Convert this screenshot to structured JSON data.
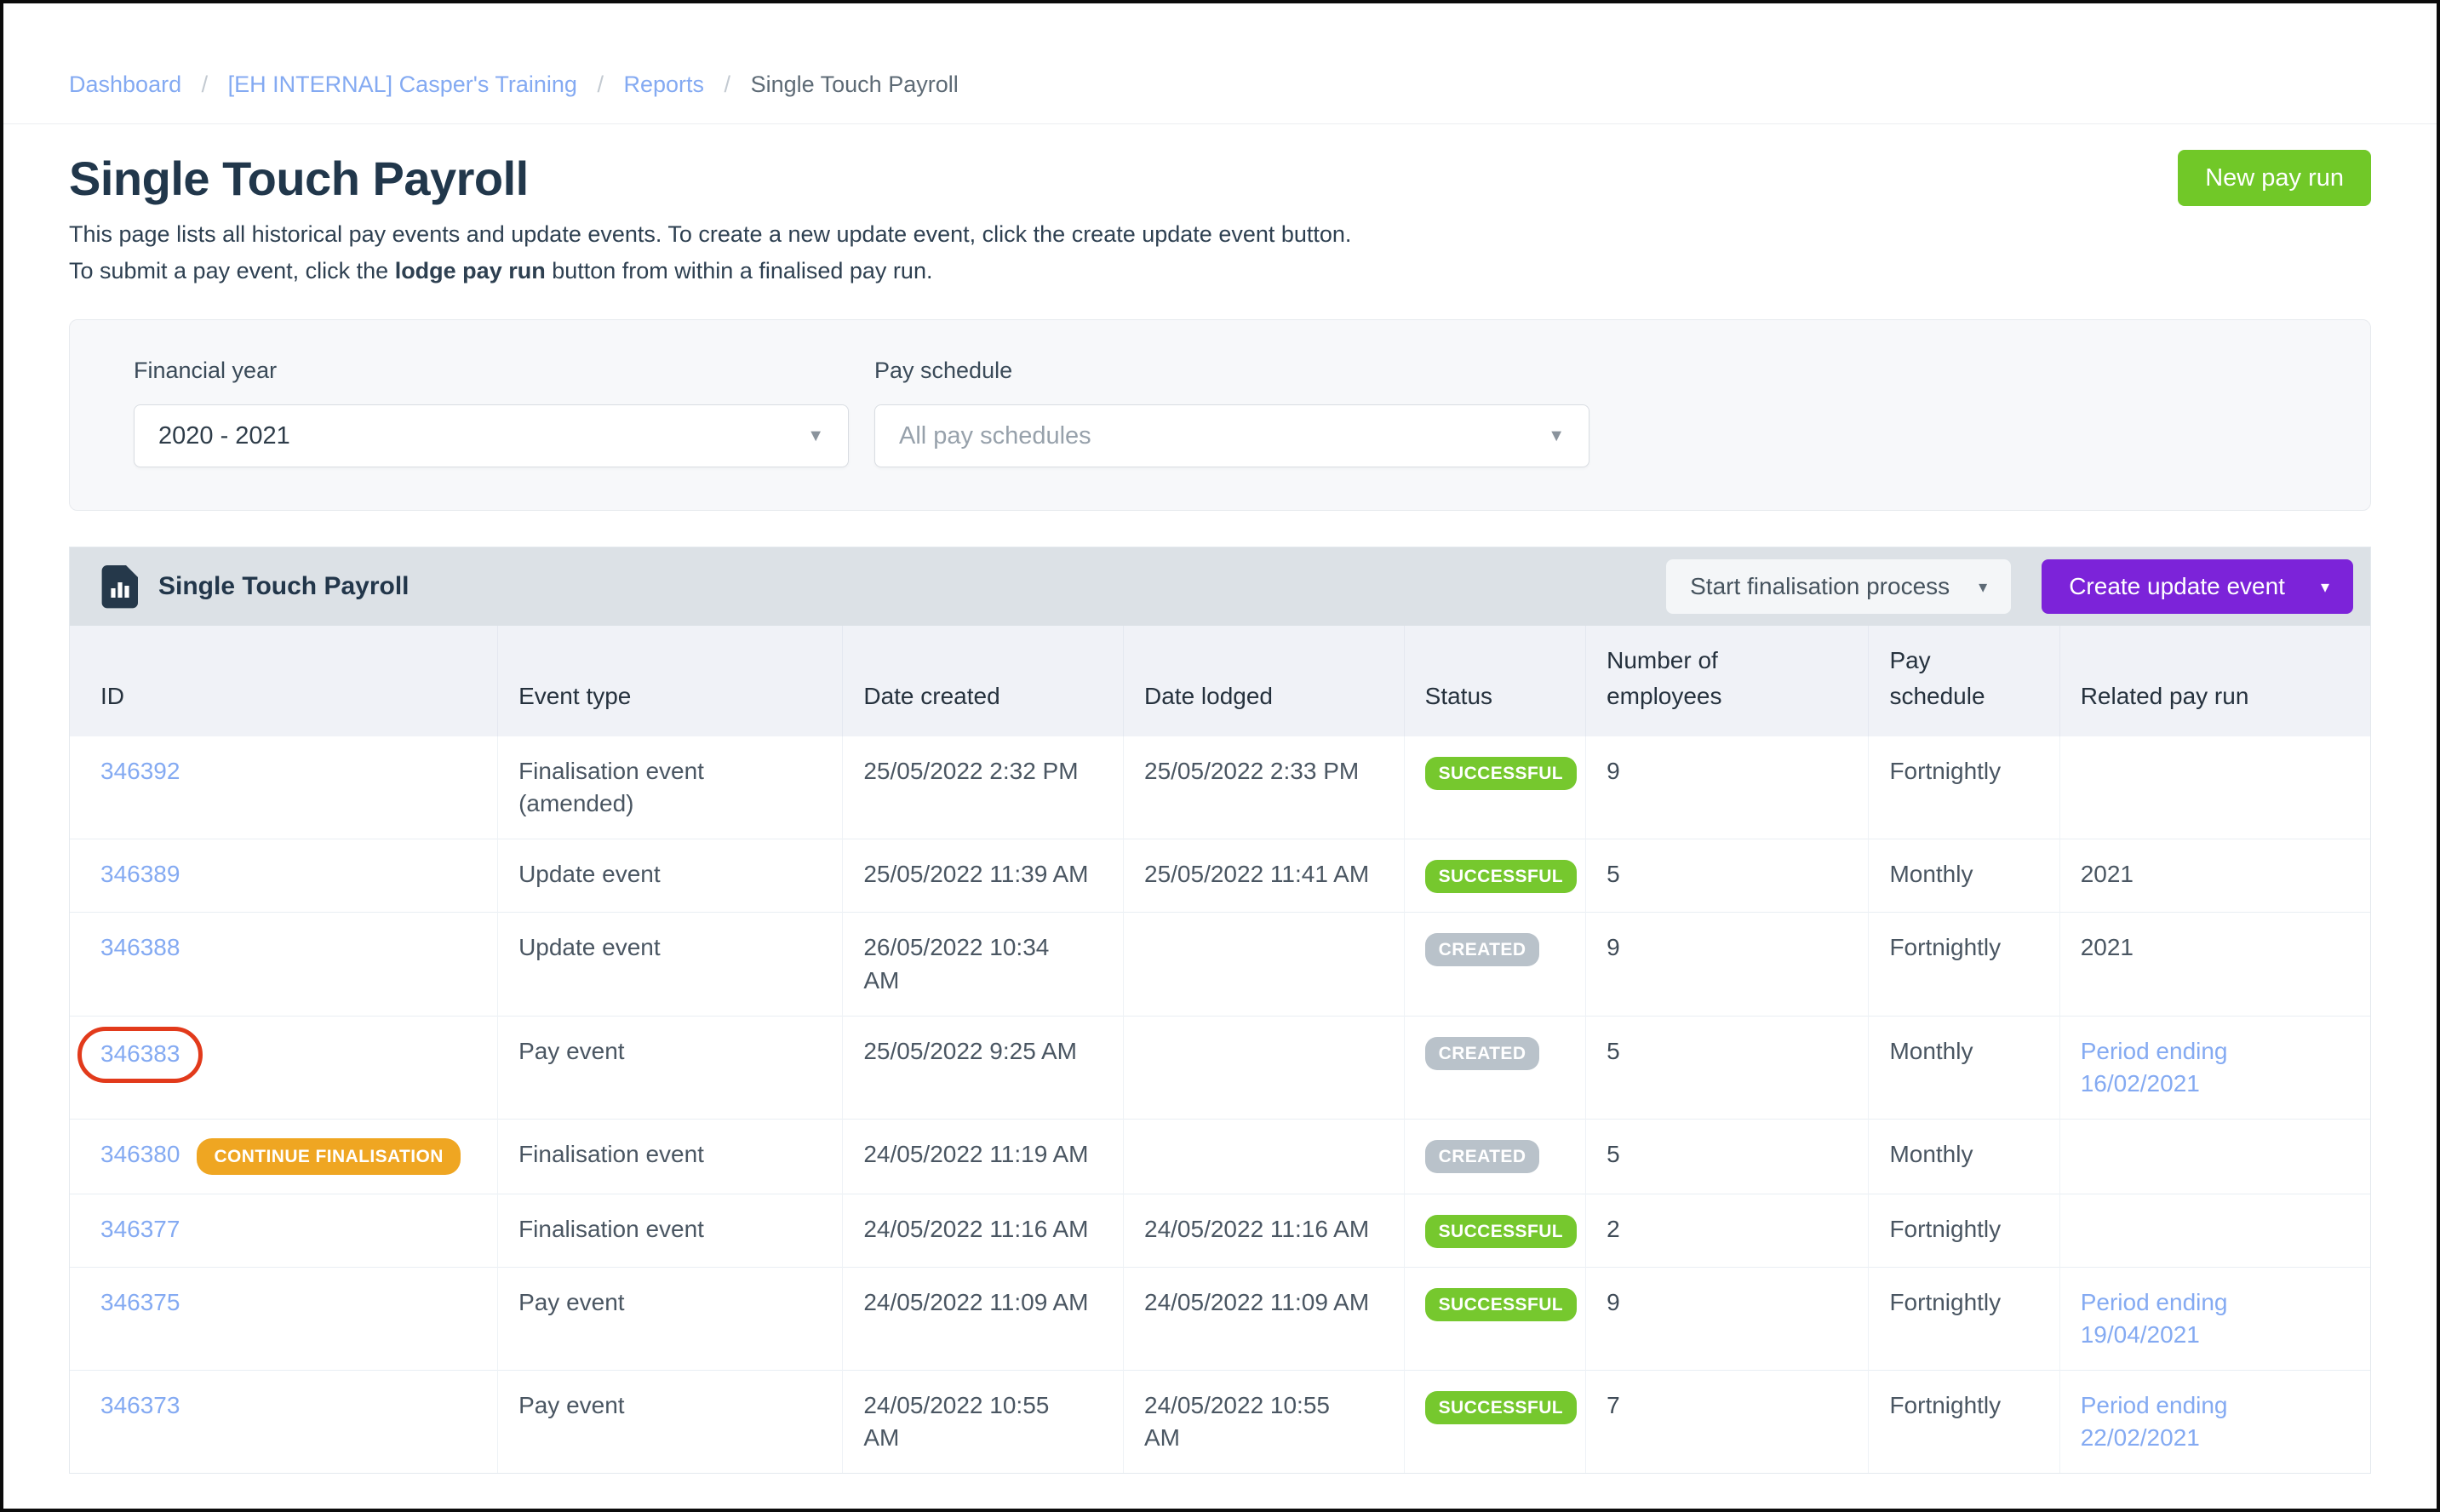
{
  "colors": {
    "accent_green": "#71c828",
    "accent_purple": "#7c23d9",
    "badge_success_green": "#76c82e",
    "badge_created_gray": "#b9c2ca",
    "badge_continue_orange": "#efa622",
    "link_blue": "#84aaf2",
    "annotation_circle_red": "#e23a1b",
    "table_bar_gray": "#dce1e6",
    "header_row_gray": "#f0f2f7"
  },
  "icons": {
    "caret_down": "▾",
    "select_caret": "▼",
    "table_icon": "bar-chart-file"
  },
  "breadcrumb": {
    "separator": "/",
    "links": [
      "Dashboard",
      "[EH INTERNAL] Casper's Training",
      "Reports"
    ],
    "current": "Single Touch Payroll"
  },
  "page_header": {
    "title": "Single Touch Payroll",
    "new_pay_run_label": "New pay run",
    "description_line1": "This page lists all historical pay events and update events. To create a new update event, click the create update event button.",
    "description_line2_prefix": "To submit a pay event, click the ",
    "description_line2_bold": "lodge pay run",
    "description_line2_suffix": " button from within a finalised pay run."
  },
  "filters": {
    "financial_year_label": "Financial year",
    "financial_year_value": "2020 - 2021",
    "pay_schedule_label": "Pay schedule",
    "pay_schedule_placeholder": "All pay schedules"
  },
  "table": {
    "title": "Single Touch Payroll",
    "start_finalisation_label": "Start finalisation process",
    "create_update_event_label": "Create update event",
    "columns": [
      "ID",
      "Event type",
      "Date created",
      "Date lodged",
      "Status",
      "Number of\nemployees",
      "Pay\nschedule",
      "Related pay run"
    ],
    "rows": [
      {
        "id": "346392",
        "circled": false,
        "id_badge": "",
        "event_type": "Finalisation event\n(amended)",
        "date_created": "25/05/2022 2:32 PM",
        "date_lodged": "25/05/2022 2:33 PM",
        "status": "SUCCESSFUL",
        "status_variant": "success",
        "employees": "9",
        "pay_schedule": "Fortnightly",
        "related": "",
        "related_is_link": false
      },
      {
        "id": "346389",
        "circled": false,
        "id_badge": "",
        "event_type": "Update event",
        "date_created": "25/05/2022 11:39 AM",
        "date_lodged": "25/05/2022 11:41 AM",
        "status": "SUCCESSFUL",
        "status_variant": "success",
        "employees": "5",
        "pay_schedule": "Monthly",
        "related": "2021",
        "related_is_link": false
      },
      {
        "id": "346388",
        "circled": false,
        "id_badge": "",
        "event_type": "Update event",
        "date_created": "26/05/2022 10:34\nAM",
        "date_lodged": "",
        "status": "CREATED",
        "status_variant": "created",
        "employees": "9",
        "pay_schedule": "Fortnightly",
        "related": "2021",
        "related_is_link": false
      },
      {
        "id": "346383",
        "circled": true,
        "id_badge": "",
        "event_type": "Pay event",
        "date_created": "25/05/2022 9:25 AM",
        "date_lodged": "",
        "status": "CREATED",
        "status_variant": "created",
        "employees": "5",
        "pay_schedule": "Monthly",
        "related": "Period ending\n16/02/2021",
        "related_is_link": true
      },
      {
        "id": "346380",
        "circled": false,
        "id_badge": "CONTINUE FINALISATION",
        "event_type": "Finalisation event",
        "date_created": "24/05/2022 11:19 AM",
        "date_lodged": "",
        "status": "CREATED",
        "status_variant": "created",
        "employees": "5",
        "pay_schedule": "Monthly",
        "related": "",
        "related_is_link": false
      },
      {
        "id": "346377",
        "circled": false,
        "id_badge": "",
        "event_type": "Finalisation event",
        "date_created": "24/05/2022 11:16 AM",
        "date_lodged": "24/05/2022 11:16 AM",
        "status": "SUCCESSFUL",
        "status_variant": "success",
        "employees": "2",
        "pay_schedule": "Fortnightly",
        "related": "",
        "related_is_link": false
      },
      {
        "id": "346375",
        "circled": false,
        "id_badge": "",
        "event_type": "Pay event",
        "date_created": "24/05/2022 11:09 AM",
        "date_lodged": "24/05/2022 11:09 AM",
        "status": "SUCCESSFUL",
        "status_variant": "success",
        "employees": "9",
        "pay_schedule": "Fortnightly",
        "related": "Period ending\n19/04/2021",
        "related_is_link": true
      },
      {
        "id": "346373",
        "circled": false,
        "id_badge": "",
        "event_type": "Pay event",
        "date_created": "24/05/2022 10:55\nAM",
        "date_lodged": "24/05/2022 10:55\nAM",
        "status": "SUCCESSFUL",
        "status_variant": "success",
        "employees": "7",
        "pay_schedule": "Fortnightly",
        "related": "Period ending\n22/02/2021",
        "related_is_link": true
      }
    ]
  }
}
